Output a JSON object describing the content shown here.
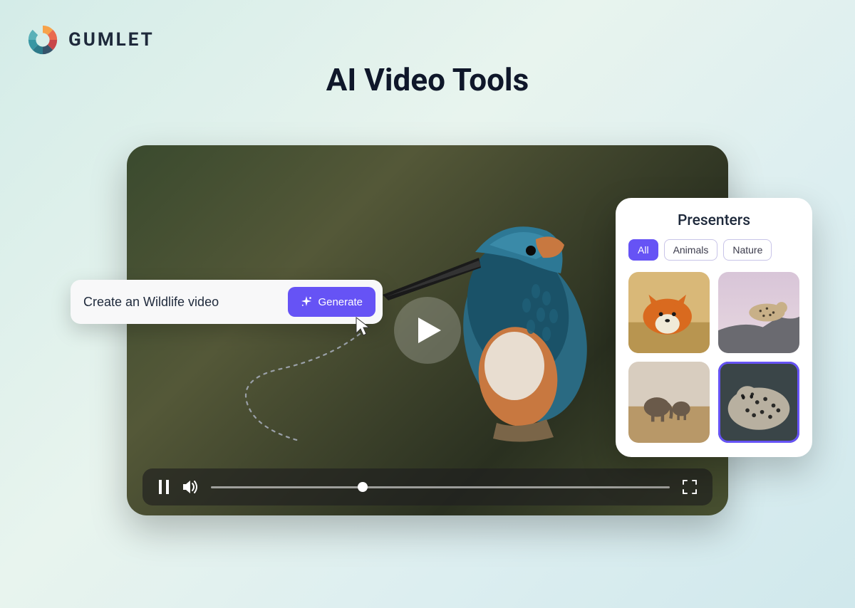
{
  "brand": {
    "name": "GUMLET"
  },
  "title": "AI Video Tools",
  "prompt": {
    "value": "Create an Wildlife video",
    "generate_label": "Generate"
  },
  "presenters": {
    "title": "Presenters",
    "tabs": [
      {
        "label": "All",
        "active": true
      },
      {
        "label": "Animals",
        "active": false
      },
      {
        "label": "Nature",
        "active": false
      }
    ],
    "items": [
      {
        "name": "fox",
        "selected": false
      },
      {
        "name": "leopard-rock",
        "selected": false
      },
      {
        "name": "elephants",
        "selected": false
      },
      {
        "name": "leopard-resting",
        "selected": true
      }
    ]
  },
  "player": {
    "progress_percent": 33
  },
  "colors": {
    "accent": "#6653f5"
  }
}
